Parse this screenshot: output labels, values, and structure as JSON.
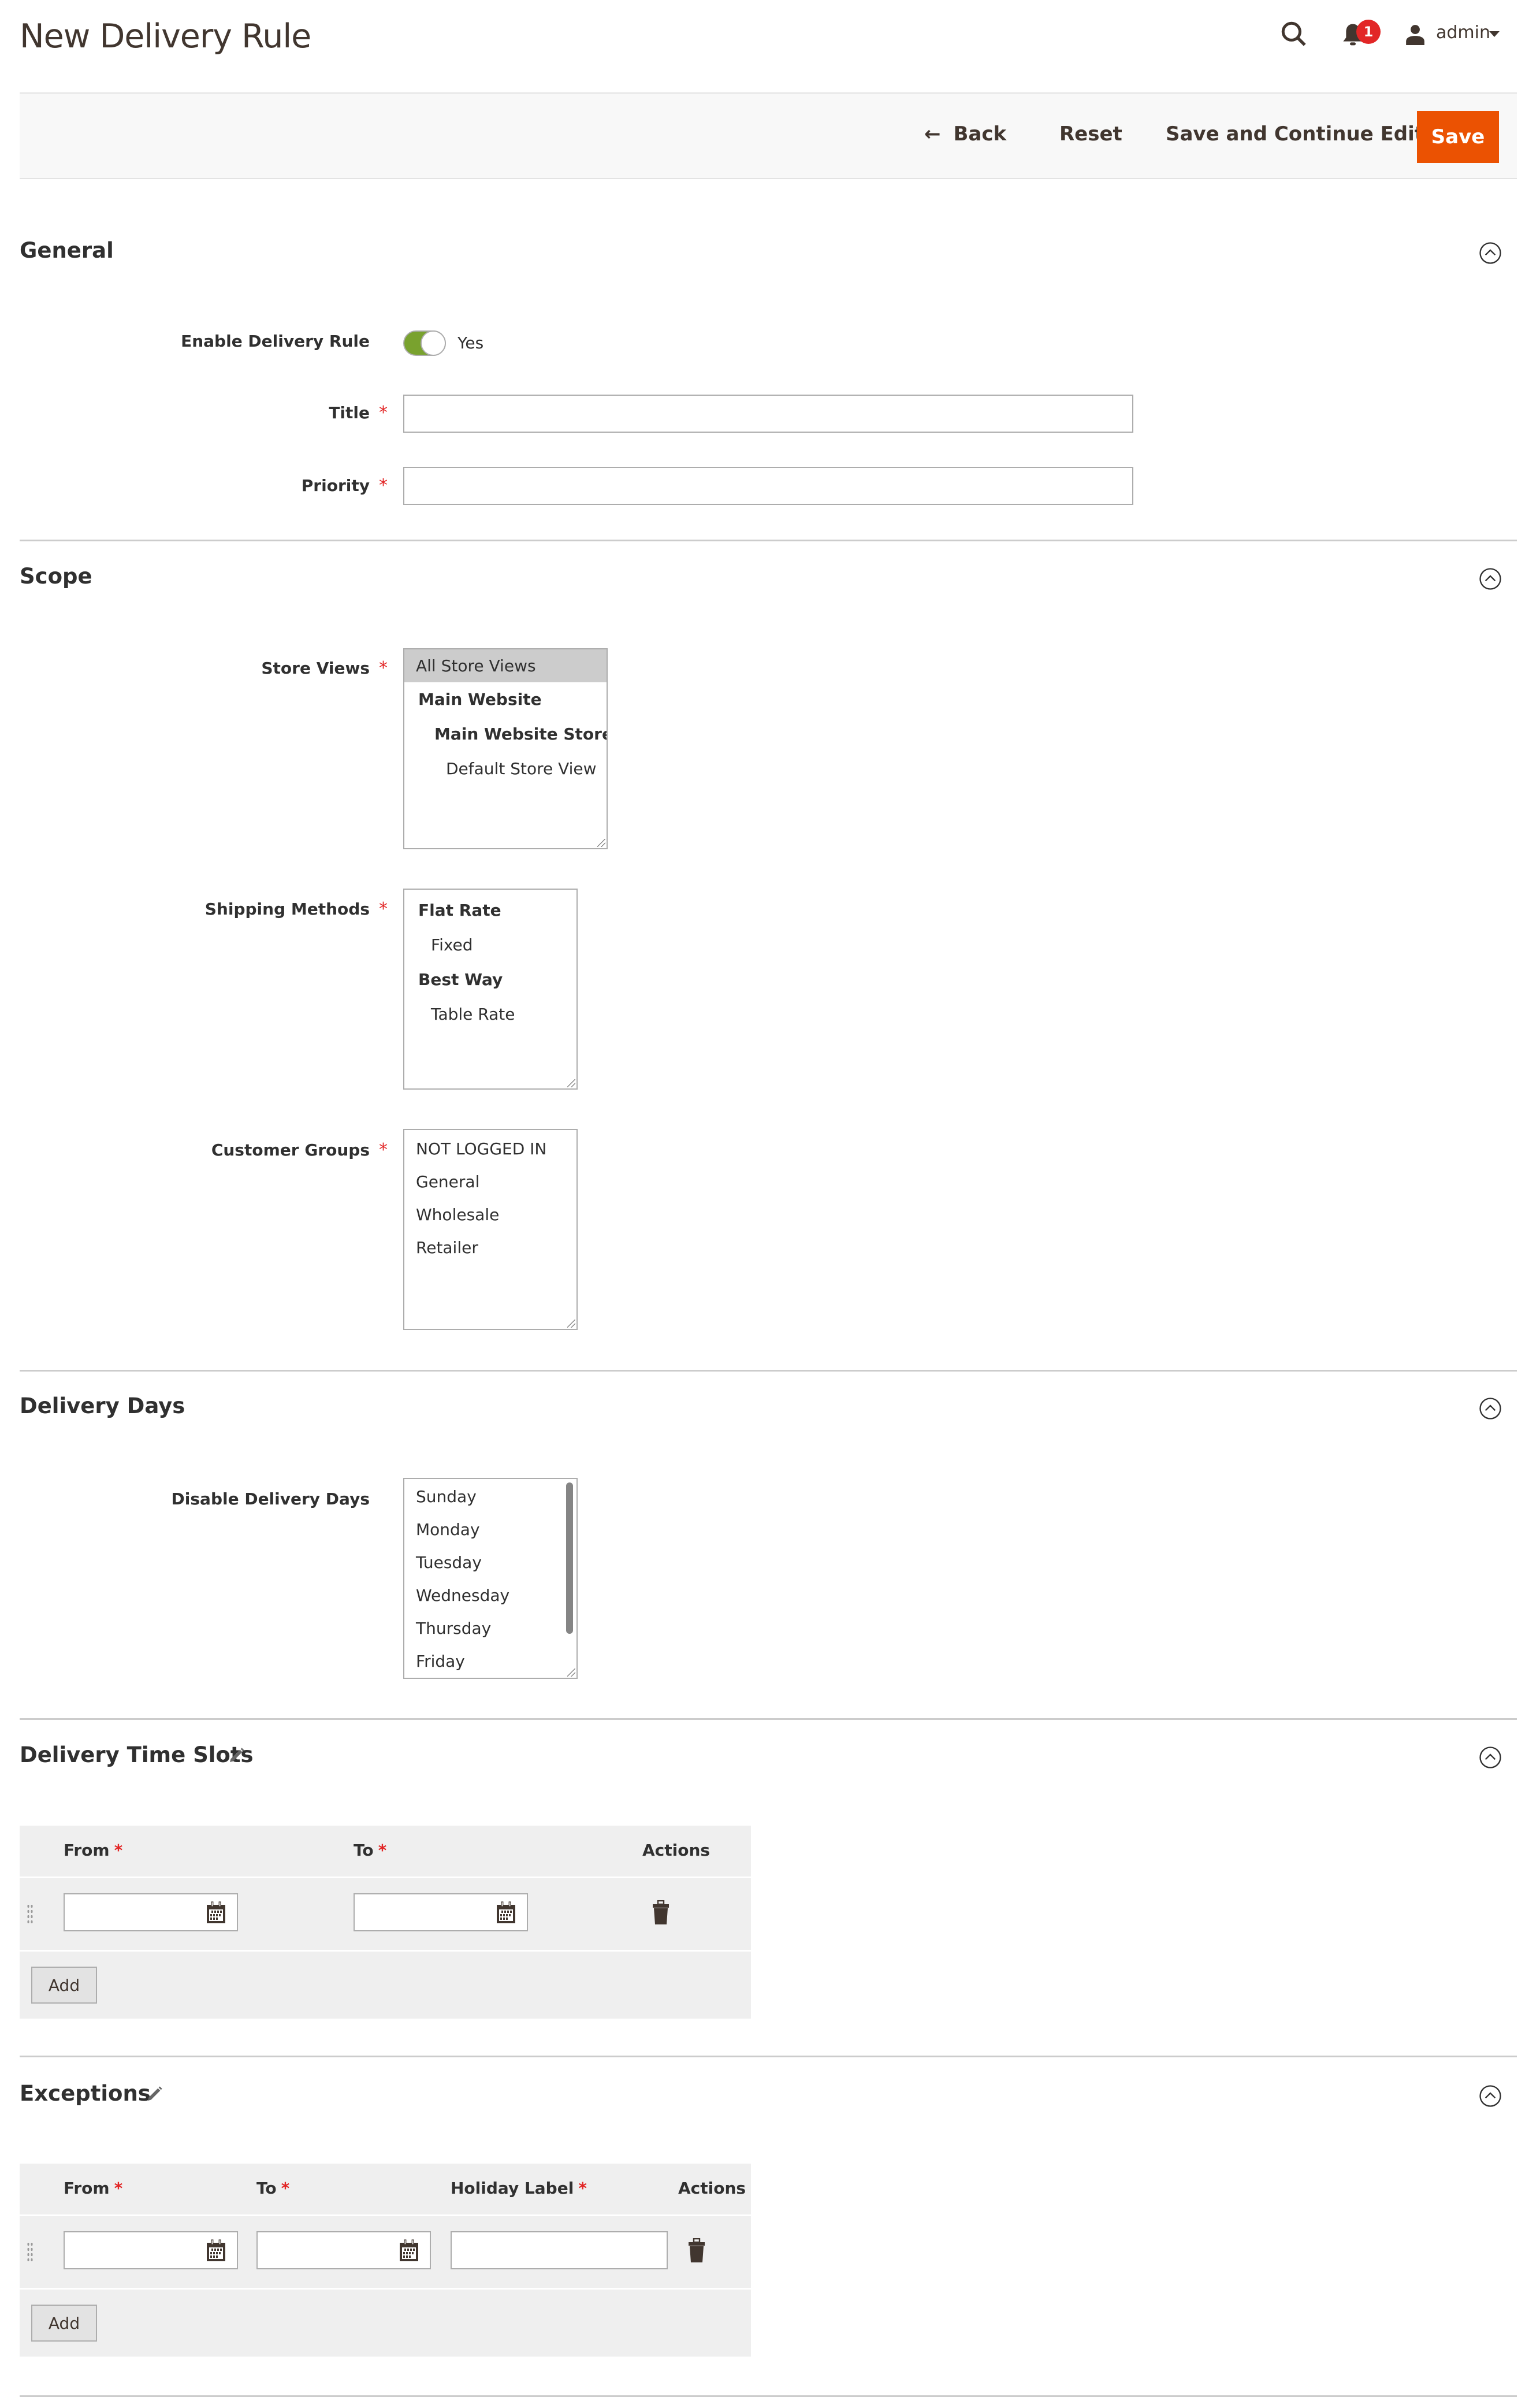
{
  "header": {
    "page_title": "New Delivery Rule",
    "notifications_count": "1",
    "user_name": "admin",
    "icons": {
      "search": "search-icon",
      "notifications": "bell-icon",
      "user": "user-icon",
      "user_menu": "caret-down-icon"
    }
  },
  "toolbar": {
    "back_label": "Back",
    "reset_label": "Reset",
    "save_continue_label": "Save and Continue Edit",
    "save_label": "Save",
    "accent_color": "#eb5202"
  },
  "general": {
    "title": "General",
    "enable_label": "Enable Delivery Rule",
    "enable_value": "Yes",
    "enable_on": true,
    "title_label": "Title",
    "title_value": "",
    "priority_label": "Priority",
    "priority_value": ""
  },
  "scope": {
    "title": "Scope",
    "store_views_label": "Store Views",
    "store_views": [
      {
        "label": "All Store Views",
        "selected": true,
        "bold": false
      },
      {
        "label": "Main Website",
        "selected": false,
        "bold": true
      },
      {
        "label": "Main Website Store",
        "selected": false,
        "bold": true
      },
      {
        "label": "Default Store View",
        "selected": false,
        "bold": false
      }
    ],
    "shipping_methods_label": "Shipping Methods",
    "shipping_methods": [
      {
        "label": "Flat Rate",
        "bold": true
      },
      {
        "label": "Fixed",
        "bold": false
      },
      {
        "label": "Best Way",
        "bold": true
      },
      {
        "label": "Table Rate",
        "bold": false
      }
    ],
    "customer_groups_label": "Customer Groups",
    "customer_groups": [
      "NOT LOGGED IN",
      "General",
      "Wholesale",
      "Retailer"
    ]
  },
  "delivery_days": {
    "title": "Delivery Days",
    "disable_label": "Disable Delivery Days",
    "days": [
      "Sunday",
      "Monday",
      "Tuesday",
      "Wednesday",
      "Thursday",
      "Friday"
    ]
  },
  "time_slots": {
    "title": "Delivery Time Slots",
    "columns": {
      "from": "From",
      "to": "To",
      "actions": "Actions"
    },
    "rows": [
      {
        "from": "",
        "to": ""
      }
    ],
    "add_label": "Add"
  },
  "exceptions": {
    "title": "Exceptions",
    "columns": {
      "from": "From",
      "to": "To",
      "holiday_label": "Holiday Label",
      "actions": "Actions"
    },
    "rows": [
      {
        "from": "",
        "to": "",
        "holiday_label": ""
      }
    ],
    "add_label": "Add"
  },
  "required_marker": "*"
}
